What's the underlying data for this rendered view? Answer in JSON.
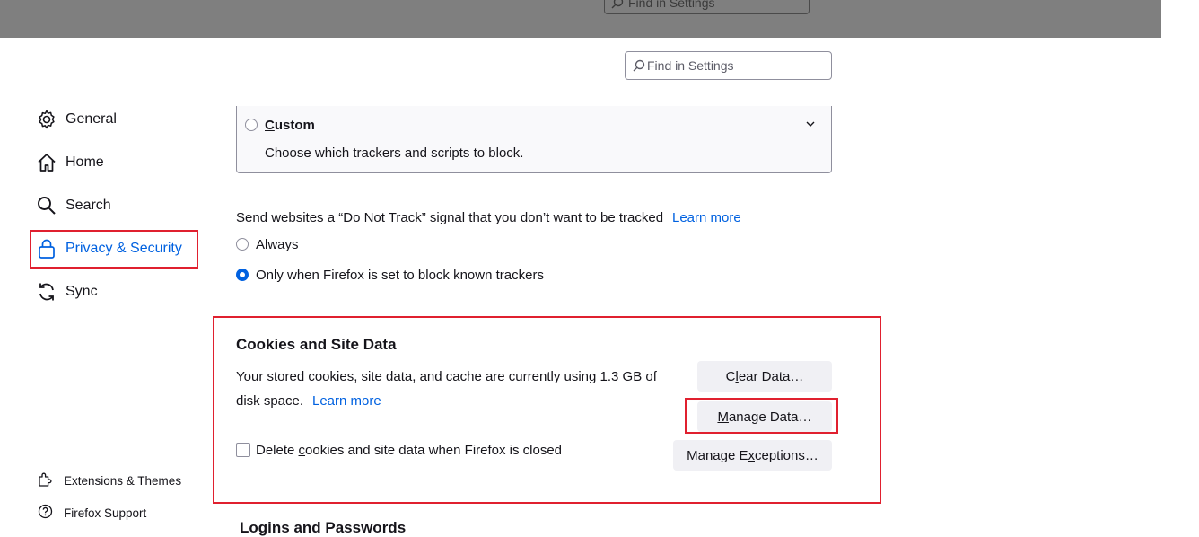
{
  "search": {
    "placeholder": "Find in Settings",
    "ghost_text": "Find in Settings"
  },
  "sidebar": {
    "items": [
      {
        "label": "General",
        "icon": "gear-icon"
      },
      {
        "label": "Home",
        "icon": "home-icon"
      },
      {
        "label": "Search",
        "icon": "magnifier-icon"
      },
      {
        "label": "Privacy & Security",
        "icon": "lock-icon",
        "active": true
      },
      {
        "label": "Sync",
        "icon": "sync-icon"
      }
    ],
    "footer": [
      {
        "label": "Extensions & Themes",
        "icon": "puzzle-icon"
      },
      {
        "label": "Firefox Support",
        "icon": "help-icon"
      }
    ]
  },
  "tracking": {
    "custom_title_accesskey": "C",
    "custom_title_rest": "ustom",
    "custom_desc": "Choose which trackers and scripts to block."
  },
  "dnt": {
    "text": "Send websites a “Do Not Track” signal that you don’t want to be tracked",
    "learn_more": "Learn more",
    "options": [
      {
        "label": "Always",
        "selected": false
      },
      {
        "label": "Only when Firefox is set to block known trackers",
        "selected": true
      }
    ]
  },
  "cookies": {
    "title": "Cookies and Site Data",
    "usage_line1": "Your stored cookies, site data, and cache are currently using 1.3 GB of",
    "usage_line2": "disk space.",
    "learn_more": "Learn more",
    "clear_data_pre": "C",
    "clear_data_key": "l",
    "clear_data_post": "ear Data…",
    "manage_data_key": "M",
    "manage_data_post": "anage Data…",
    "manage_exceptions_pre": "Manage E",
    "manage_exceptions_key": "x",
    "manage_exceptions_post": "ceptions…",
    "delete_on_close_pre": "Delete ",
    "delete_on_close_key": "c",
    "delete_on_close_post": "ookies and site data when Firefox is closed",
    "delete_on_close_checked": false
  },
  "next_section": {
    "title": "Logins and Passwords"
  },
  "colors": {
    "accent": "#0061e0",
    "highlight": "#e0202f",
    "button_bg": "#f0f0f4"
  }
}
